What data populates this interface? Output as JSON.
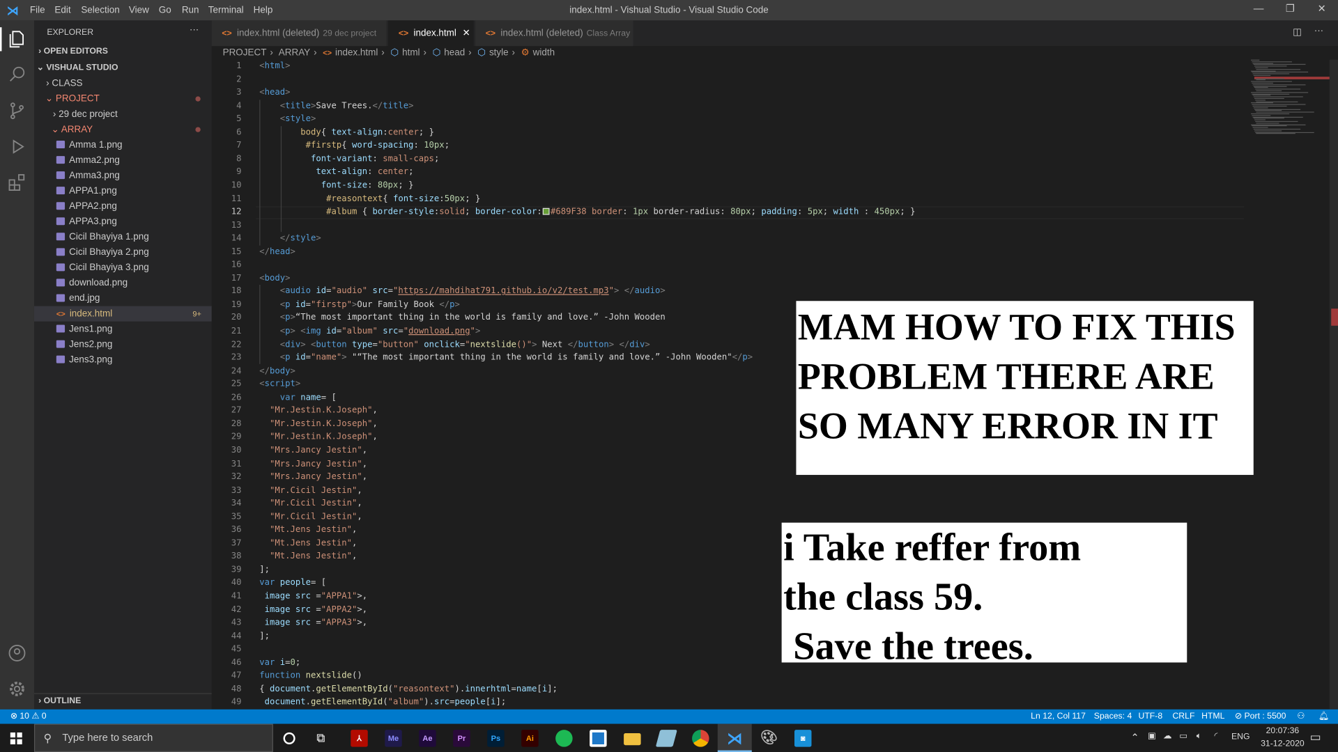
{
  "window": {
    "title": "index.html - Vishual Studio - Visual Studio Code",
    "menu": [
      "File",
      "Edit",
      "Selection",
      "View",
      "Go",
      "Run",
      "Terminal",
      "Help"
    ]
  },
  "sidebar": {
    "header": "EXPLORER",
    "open_editors": "OPEN EDITORS",
    "workspace": "VISHUAL STUDIO",
    "outline": "OUTLINE",
    "folders": {
      "class": "CLASS",
      "project": "PROJECT",
      "dec": "29 dec project",
      "array": "ARRAY"
    },
    "files": [
      "Amma 1.png",
      "Amma2.png",
      "Amma3.png",
      "APPA1.png",
      "APPA2.png",
      "APPA3.png",
      "Cicil Bhayiya 1.png",
      "Cicil Bhayiya 2.png",
      "Cicil Bhayiya 3.png",
      "download.png",
      "end.jpg",
      "index.html",
      "Jens1.png",
      "Jens2.png",
      "Jens3.png"
    ],
    "index_badge": "9+"
  },
  "tabs": [
    {
      "label": "index.html (deleted)",
      "desc": "29 dec project"
    },
    {
      "label": "index.html",
      "desc": ""
    },
    {
      "label": "index.html (deleted)",
      "desc": "Class Array"
    }
  ],
  "breadcrumb": [
    "PROJECT",
    "ARRAY",
    "index.html",
    "html",
    "head",
    "style",
    "width"
  ],
  "code": [
    [
      [
        "b",
        "<"
      ],
      [
        "tn",
        "html"
      ],
      [
        "b",
        ">"
      ]
    ],
    [],
    [
      [
        "b",
        "<"
      ],
      [
        "tn",
        "head"
      ],
      [
        "b",
        ">"
      ]
    ],
    [
      [
        "tx",
        "    "
      ],
      [
        "b",
        "<"
      ],
      [
        "tn",
        "title"
      ],
      [
        "b",
        ">"
      ],
      [
        "tx",
        "Save Trees."
      ],
      [
        "b",
        "</"
      ],
      [
        "tn",
        "title"
      ],
      [
        "b",
        ">"
      ]
    ],
    [
      [
        "tx",
        "    "
      ],
      [
        "b",
        "<"
      ],
      [
        "tn",
        "style"
      ],
      [
        "b",
        ">"
      ]
    ],
    [
      [
        "tx",
        "        "
      ],
      [
        "sel",
        "body"
      ],
      [
        "tx",
        "{ "
      ],
      [
        "pr",
        "text-align"
      ],
      [
        "tx",
        ":"
      ],
      [
        "v",
        "center"
      ],
      [
        "tx",
        "; }"
      ]
    ],
    [
      [
        "tx",
        "         "
      ],
      [
        "sel",
        "#firstp"
      ],
      [
        "tx",
        "{ "
      ],
      [
        "pr",
        "word-spacing"
      ],
      [
        "tx",
        ": "
      ],
      [
        "n",
        "10px"
      ],
      [
        "tx",
        ";"
      ]
    ],
    [
      [
        "tx",
        "          "
      ],
      [
        "pr",
        "font-variant"
      ],
      [
        "tx",
        ": "
      ],
      [
        "v",
        "small-caps"
      ],
      [
        "tx",
        ";"
      ]
    ],
    [
      [
        "tx",
        "           "
      ],
      [
        "pr",
        "text-align"
      ],
      [
        "tx",
        ": "
      ],
      [
        "v",
        "center"
      ],
      [
        "tx",
        ";"
      ]
    ],
    [
      [
        "tx",
        "            "
      ],
      [
        "pr",
        "font-size"
      ],
      [
        "tx",
        ": "
      ],
      [
        "n",
        "80px"
      ],
      [
        "tx",
        "; }"
      ]
    ],
    [
      [
        "tx",
        "             "
      ],
      [
        "sel",
        "#reasontext"
      ],
      [
        "tx",
        "{ "
      ],
      [
        "pr",
        "font-size"
      ],
      [
        "tx",
        ":"
      ],
      [
        "n",
        "50px"
      ],
      [
        "tx",
        "; }"
      ]
    ],
    [
      [
        "tx",
        "             "
      ],
      [
        "sel",
        "#album"
      ],
      [
        "tx",
        " { "
      ],
      [
        "pr",
        "border-style"
      ],
      [
        "tx",
        ":"
      ],
      [
        "v",
        "solid"
      ],
      [
        "tx",
        "; "
      ],
      [
        "pr",
        "border-color"
      ],
      [
        "tx",
        ":"
      ],
      [
        "sw",
        ""
      ],
      [
        "v",
        "#689F38 border"
      ],
      [
        "tx",
        ": "
      ],
      [
        "n",
        "1px"
      ],
      [
        "tx",
        " border-radius: "
      ],
      [
        "n",
        "80px"
      ],
      [
        "tx",
        "; "
      ],
      [
        "pr",
        "padding"
      ],
      [
        "tx",
        ": "
      ],
      [
        "n",
        "5px"
      ],
      [
        "tx",
        "; "
      ],
      [
        "pr",
        "width"
      ],
      [
        "tx",
        " : "
      ],
      [
        "n",
        "450px"
      ],
      [
        "tx",
        "; }"
      ]
    ],
    [],
    [
      [
        "tx",
        "    "
      ],
      [
        "b",
        "</"
      ],
      [
        "tn",
        "style"
      ],
      [
        "b",
        ">"
      ]
    ],
    [
      [
        "b",
        "</"
      ],
      [
        "tn",
        "head"
      ],
      [
        "b",
        ">"
      ]
    ],
    [],
    [
      [
        "b",
        "<"
      ],
      [
        "tn",
        "body"
      ],
      [
        "b",
        ">"
      ]
    ],
    [
      [
        "tx",
        "    "
      ],
      [
        "b",
        "<"
      ],
      [
        "tn",
        "audio"
      ],
      [
        "tx",
        " "
      ],
      [
        "at",
        "id"
      ],
      [
        "tx",
        "="
      ],
      [
        "s",
        "\"audio\""
      ],
      [
        "tx",
        " "
      ],
      [
        "at",
        "src"
      ],
      [
        "tx",
        "="
      ],
      [
        "s",
        "\""
      ],
      [
        "u",
        "https://mahdihat791.github.io/v2/test.mp3"
      ],
      [
        "s",
        "\""
      ],
      [
        "b",
        "> </"
      ],
      [
        "tn",
        "audio"
      ],
      [
        "b",
        ">"
      ]
    ],
    [
      [
        "tx",
        "    "
      ],
      [
        "b",
        "<"
      ],
      [
        "tn",
        "p"
      ],
      [
        "tx",
        " "
      ],
      [
        "at",
        "id"
      ],
      [
        "tx",
        "="
      ],
      [
        "s",
        "\"firstp\""
      ],
      [
        "b",
        ">"
      ],
      [
        "tx",
        "Our Family Book "
      ],
      [
        "b",
        "</"
      ],
      [
        "tn",
        "p"
      ],
      [
        "b",
        ">"
      ]
    ],
    [
      [
        "tx",
        "    "
      ],
      [
        "b",
        "<"
      ],
      [
        "tn",
        "p"
      ],
      [
        "b",
        ">"
      ],
      [
        "tx",
        "“The most important thing in the world is family and love.” -John Wooden"
      ]
    ],
    [
      [
        "tx",
        "    "
      ],
      [
        "b",
        "<"
      ],
      [
        "tn",
        "p"
      ],
      [
        "b",
        "> <"
      ],
      [
        "tn",
        "img"
      ],
      [
        "tx",
        " "
      ],
      [
        "at",
        "id"
      ],
      [
        "tx",
        "="
      ],
      [
        "s",
        "\"album\""
      ],
      [
        "tx",
        " "
      ],
      [
        "at",
        "src"
      ],
      [
        "tx",
        "="
      ],
      [
        "s",
        "\""
      ],
      [
        "u",
        "download.png"
      ],
      [
        "s",
        "\""
      ],
      [
        "b",
        ">"
      ]
    ],
    [
      [
        "tx",
        "    "
      ],
      [
        "b",
        "<"
      ],
      [
        "tn",
        "div"
      ],
      [
        "b",
        "> <"
      ],
      [
        "tn",
        "button"
      ],
      [
        "tx",
        " "
      ],
      [
        "at",
        "type"
      ],
      [
        "tx",
        "="
      ],
      [
        "s",
        "\"button\""
      ],
      [
        "tx",
        " "
      ],
      [
        "at",
        "onclick"
      ],
      [
        "tx",
        "="
      ],
      [
        "s",
        "\""
      ],
      [
        "f",
        "nextslide"
      ],
      [
        "s",
        "()\""
      ],
      [
        "b",
        ">"
      ],
      [
        "tx",
        " Next "
      ],
      [
        "b",
        "</"
      ],
      [
        "tn",
        "button"
      ],
      [
        "b",
        "> </"
      ],
      [
        "tn",
        "div"
      ],
      [
        "b",
        ">"
      ]
    ],
    [
      [
        "tx",
        "    "
      ],
      [
        "b",
        "<"
      ],
      [
        "tn",
        "p"
      ],
      [
        "tx",
        " "
      ],
      [
        "at",
        "id"
      ],
      [
        "tx",
        "="
      ],
      [
        "s",
        "\"name\""
      ],
      [
        "b",
        ">"
      ],
      [
        "tx",
        " \"“The most important thing in the world is family and love.” -John Wooden\""
      ],
      [
        "b",
        "</"
      ],
      [
        "tn",
        "p"
      ],
      [
        "b",
        ">"
      ]
    ],
    [
      [
        "b",
        "</"
      ],
      [
        "tn",
        "body"
      ],
      [
        "b",
        ">"
      ]
    ],
    [
      [
        "b",
        "<"
      ],
      [
        "tn",
        "script"
      ],
      [
        "b",
        ">"
      ]
    ],
    [
      [
        "tx",
        "    "
      ],
      [
        "k",
        "var"
      ],
      [
        "tx",
        " "
      ],
      [
        "at",
        "name"
      ],
      [
        "tx",
        "= ["
      ]
    ],
    [
      [
        "tx",
        "  "
      ],
      [
        "s",
        "\"Mr.Jestin.K.Joseph\""
      ],
      [
        "tx",
        ","
      ]
    ],
    [
      [
        "tx",
        "  "
      ],
      [
        "s",
        "\"Mr.Jestin.K.Joseph\""
      ],
      [
        "tx",
        ","
      ]
    ],
    [
      [
        "tx",
        "  "
      ],
      [
        "s",
        "\"Mr.Jestin.K.Joseph\""
      ],
      [
        "tx",
        ","
      ]
    ],
    [
      [
        "tx",
        "  "
      ],
      [
        "s",
        "\"Mrs.Jancy Jestin\""
      ],
      [
        "tx",
        ","
      ]
    ],
    [
      [
        "tx",
        "  "
      ],
      [
        "s",
        "\"Mrs.Jancy Jestin\""
      ],
      [
        "tx",
        ","
      ]
    ],
    [
      [
        "tx",
        "  "
      ],
      [
        "s",
        "\"Mrs.Jancy Jestin\""
      ],
      [
        "tx",
        ","
      ]
    ],
    [
      [
        "tx",
        "  "
      ],
      [
        "s",
        "\"Mr.Cicil Jestin\""
      ],
      [
        "tx",
        ","
      ]
    ],
    [
      [
        "tx",
        "  "
      ],
      [
        "s",
        "\"Mr.Cicil Jestin\""
      ],
      [
        "tx",
        ","
      ]
    ],
    [
      [
        "tx",
        "  "
      ],
      [
        "s",
        "\"Mr.Cicil Jestin\""
      ],
      [
        "tx",
        ","
      ]
    ],
    [
      [
        "tx",
        "  "
      ],
      [
        "s",
        "\"Mt.Jens Jestin\""
      ],
      [
        "tx",
        ","
      ]
    ],
    [
      [
        "tx",
        "  "
      ],
      [
        "s",
        "\"Mt.Jens Jestin\""
      ],
      [
        "tx",
        ","
      ]
    ],
    [
      [
        "tx",
        "  "
      ],
      [
        "s",
        "\"Mt.Jens Jestin\""
      ],
      [
        "tx",
        ","
      ]
    ],
    [
      [
        "tx",
        "];"
      ]
    ],
    [
      [
        "k",
        "var"
      ],
      [
        "tx",
        " "
      ],
      [
        "at",
        "people"
      ],
      [
        "tx",
        "= ["
      ]
    ],
    [
      [
        "tx",
        " "
      ],
      [
        "at",
        "image"
      ],
      [
        "tx",
        " "
      ],
      [
        "at",
        "src"
      ],
      [
        "tx",
        " ="
      ],
      [
        "s",
        "\"APPA1\""
      ],
      [
        "tx",
        ">,"
      ]
    ],
    [
      [
        "tx",
        " "
      ],
      [
        "at",
        "image"
      ],
      [
        "tx",
        " "
      ],
      [
        "at",
        "src"
      ],
      [
        "tx",
        " ="
      ],
      [
        "s",
        "\"APPA2\""
      ],
      [
        "tx",
        ">,"
      ]
    ],
    [
      [
        "tx",
        " "
      ],
      [
        "at",
        "image"
      ],
      [
        "tx",
        " "
      ],
      [
        "at",
        "src"
      ],
      [
        "tx",
        " ="
      ],
      [
        "s",
        "\"APPA3\""
      ],
      [
        "tx",
        ">,"
      ]
    ],
    [
      [
        "tx",
        "];"
      ]
    ],
    [],
    [
      [
        "k",
        "var"
      ],
      [
        "tx",
        " "
      ],
      [
        "at",
        "i"
      ],
      [
        "tx",
        "="
      ],
      [
        "n",
        "0"
      ],
      [
        "tx",
        ";"
      ]
    ],
    [
      [
        "k",
        "function"
      ],
      [
        "tx",
        " "
      ],
      [
        "f",
        "nextslide"
      ],
      [
        "tx",
        "()"
      ]
    ],
    [
      [
        "tx",
        "{ "
      ],
      [
        "at",
        "document"
      ],
      [
        "tx",
        "."
      ],
      [
        "f",
        "getElementById"
      ],
      [
        "tx",
        "("
      ],
      [
        "s",
        "\"reasontext\""
      ],
      [
        "tx",
        ")."
      ],
      [
        "at",
        "innerhtml"
      ],
      [
        "tx",
        "="
      ],
      [
        "at",
        "name"
      ],
      [
        "tx",
        "["
      ],
      [
        "at",
        "i"
      ],
      [
        "tx",
        "];"
      ]
    ],
    [
      [
        "tx",
        " "
      ],
      [
        "at",
        "document"
      ],
      [
        "tx",
        "."
      ],
      [
        "f",
        "getElementById"
      ],
      [
        "tx",
        "("
      ],
      [
        "s",
        "\"album\""
      ],
      [
        "tx",
        ")."
      ],
      [
        "at",
        "src"
      ],
      [
        "tx",
        "="
      ],
      [
        "at",
        "people"
      ],
      [
        "tx",
        "["
      ],
      [
        "at",
        "i"
      ],
      [
        "tx",
        "];"
      ]
    ]
  ],
  "current_line": 12,
  "notes": {
    "box1": "MAM HOW TO FIX THIS\nPROBLEM THERE ARE\nSO MANY ERROR IN IT",
    "box2": "i Take reffer from\nthe class 59.\n Save the trees."
  },
  "statusbar": {
    "errors": "10",
    "warnings": "0",
    "position": "Ln 12, Col 117",
    "spaces": "Spaces: 4",
    "encoding": "UTF-8",
    "eol": "CRLF",
    "language": "HTML",
    "port": "Port : 5500",
    "accent": "#007acc"
  },
  "taskbar": {
    "search_placeholder": "Type here to search",
    "apps": [
      "Me",
      "Ae",
      "Pr",
      "Ps",
      "Ai"
    ],
    "lang": "ENG",
    "time": "20:07:36",
    "date": "31-12-2020"
  }
}
